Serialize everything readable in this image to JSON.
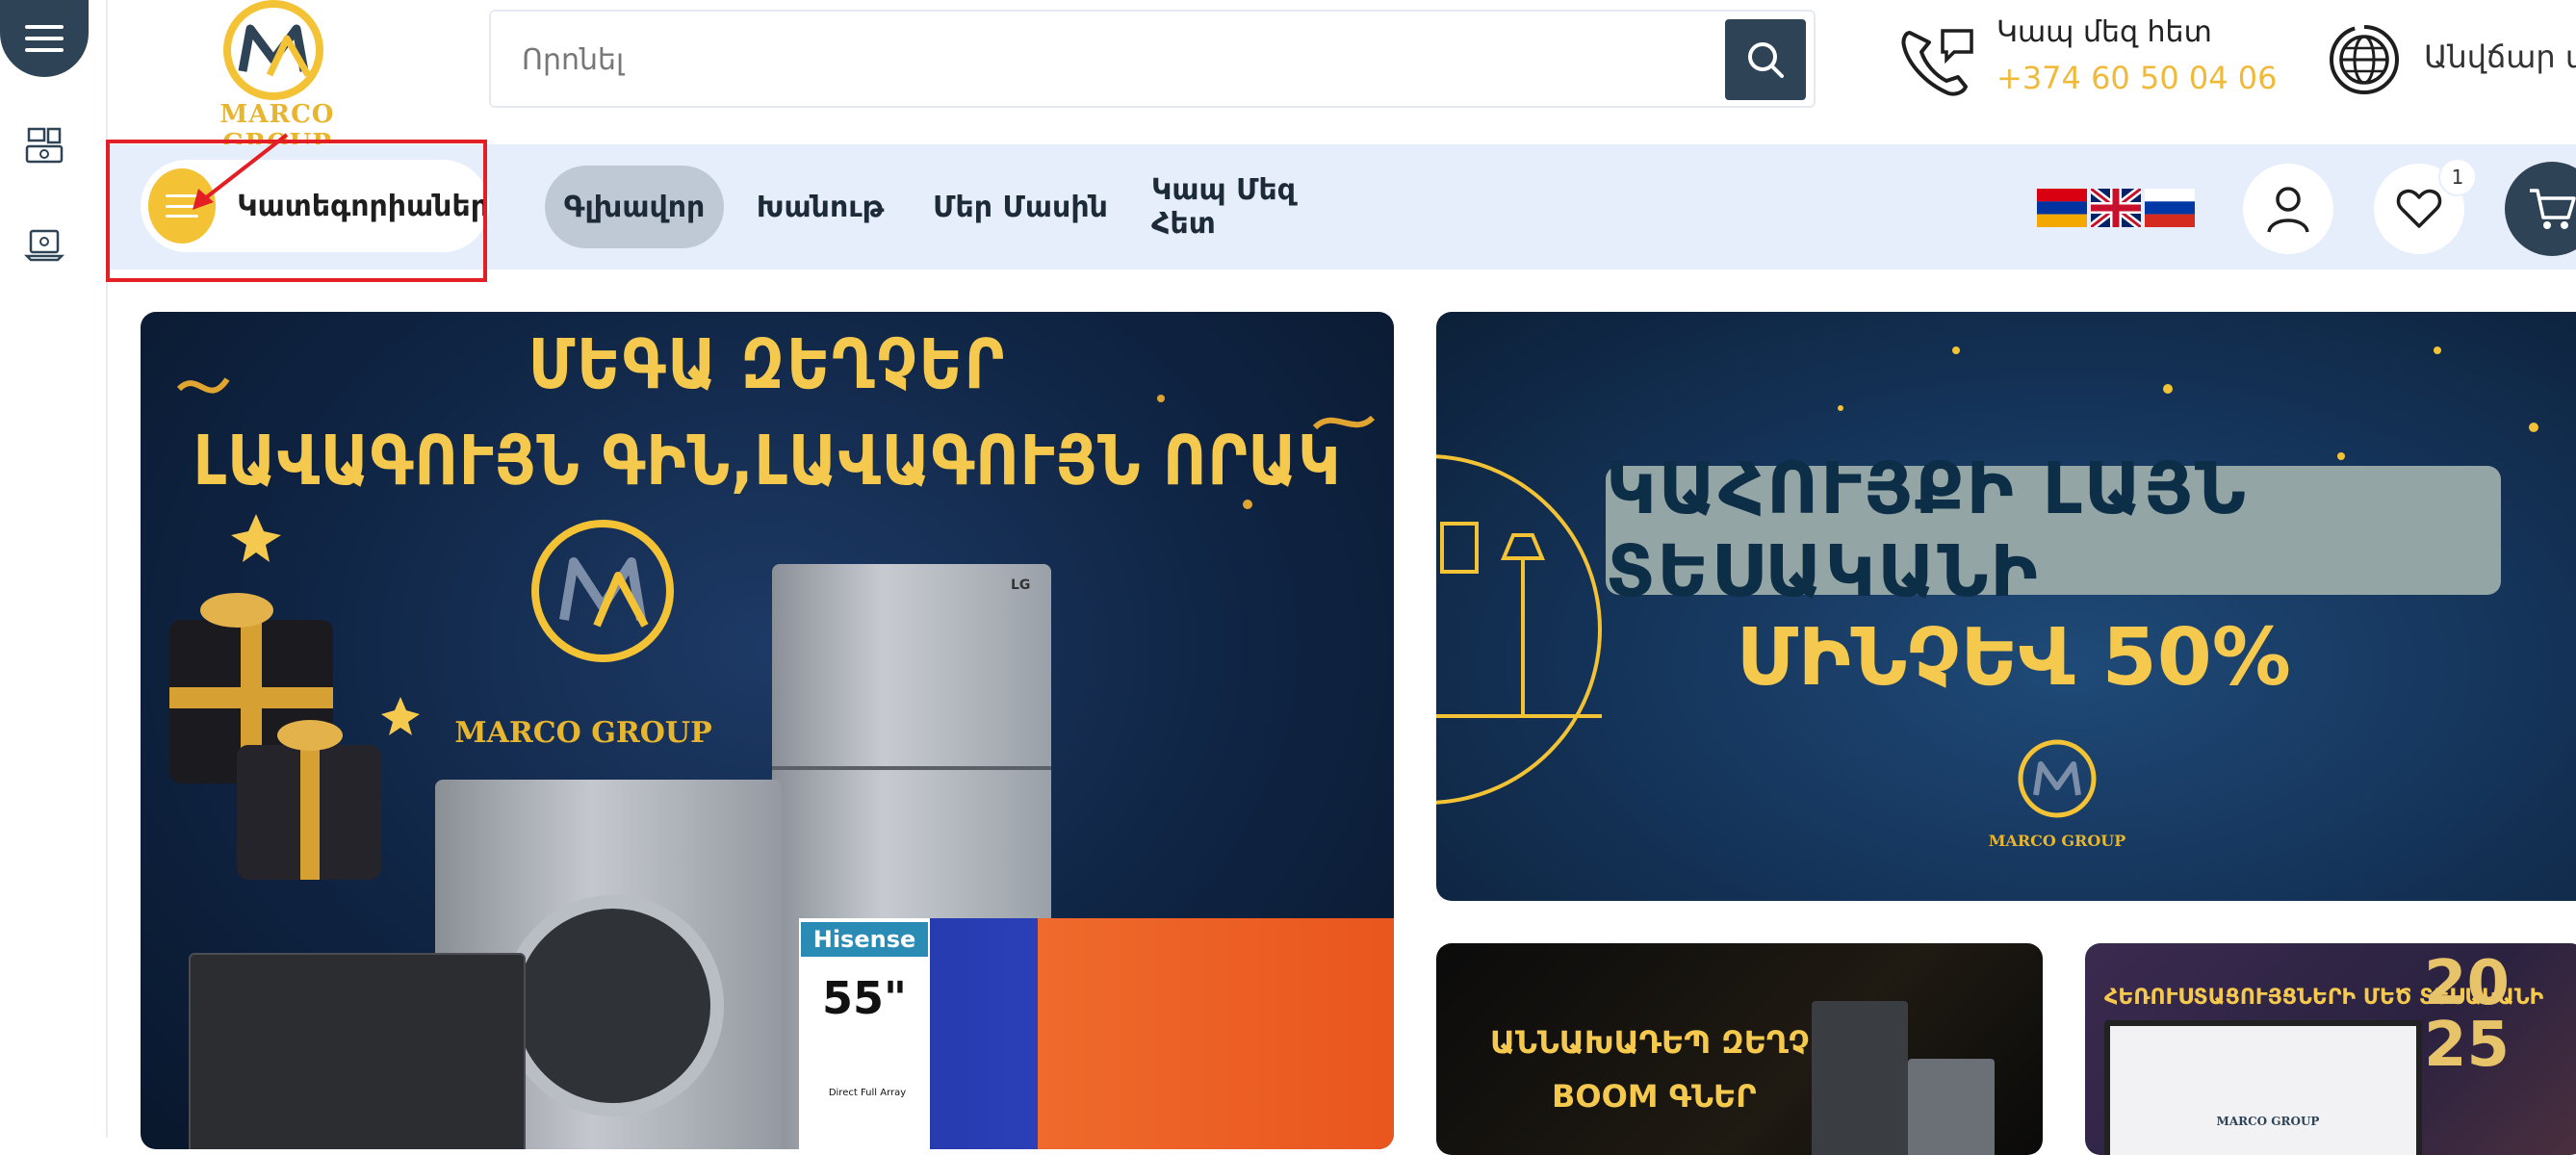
{
  "brand": {
    "name": "MARCO GROUP"
  },
  "search": {
    "placeholder": "Որոնել"
  },
  "contact": {
    "label": "Կապ մեզ հետ",
    "phone": "+374 60 50 04 06"
  },
  "shipping": {
    "label": "Անվճար ա"
  },
  "categories": {
    "label": "Կատեգորիաներ"
  },
  "nav": {
    "items": [
      {
        "label": "Գլխավոր",
        "active": true
      },
      {
        "label": "Խանութ",
        "active": false
      },
      {
        "label": "Մեր Մասին",
        "active": false
      },
      {
        "label": "Կապ Մեզ Հետ",
        "active": false
      }
    ]
  },
  "flags": [
    "armenian-flag",
    "uk-flag",
    "russian-flag"
  ],
  "wishlist": {
    "count": "1"
  },
  "banners": {
    "main": {
      "line1": "ՄԵԳԱ ԶԵՂՉԵՐ",
      "line2": "ԼԱՎԱԳՈՒՅՆ ԳԻՆ,ԼԱՎԱԳՈՒՅՆ ՈՐԱԿ",
      "brand": "MARCO GROUP",
      "tv_brand": "Hisense",
      "tv_size": "55\"",
      "tv_caption": "Direct Full Array",
      "fridge_brand": "LG"
    },
    "right": {
      "title": "ԿԱՀՈՒՅՔԻ ԼԱՅՆ ՏԵՍԱԿԱՆԻ",
      "sale": "ՄԻՆՉԵՎ 50%",
      "brand": "MARCO GROUP"
    },
    "small1": {
      "line1": "ԱՆՆԱԽԱԴԵՊ ԶԵՂՉԵՐ",
      "line2": "BOOM ԳՆԵՐ"
    },
    "small2": {
      "title": "ՀԵՌՈՒՍՏԱՑՈՒՅՑՆԵՐԻ ՄԵԾ ՏԵՍԱԿԱՆԻ",
      "year": "2025",
      "brand": "MARCO GROUP"
    }
  },
  "colors": {
    "navy": "#2e4356",
    "gold": "#f3c335",
    "nav_bg": "#e7eefb",
    "highlight": "#e31e24"
  }
}
